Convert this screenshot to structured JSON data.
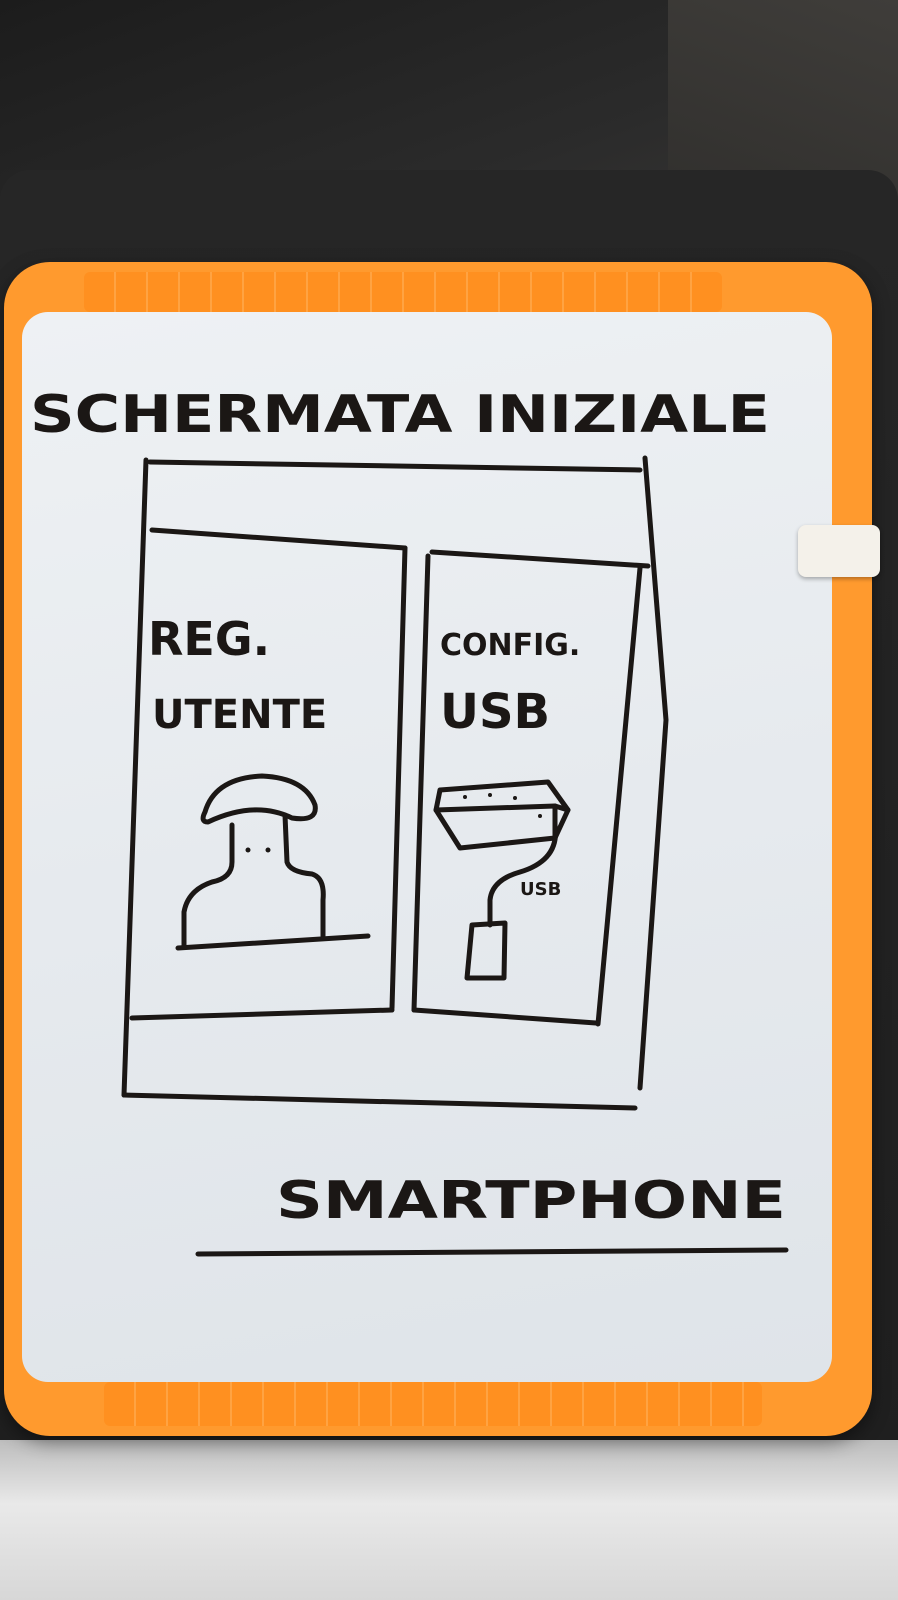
{
  "whiteboard": {
    "title": "SCHERMATA INIZIALE",
    "left_panel": {
      "line1": "REG.",
      "line2": "UTENTE"
    },
    "right_panel": {
      "line1": "CONFIG.",
      "line2": "USB",
      "cable_label": "USB"
    },
    "caption": "SMARTPHONE"
  },
  "colors": {
    "frame": "#ff9a2e",
    "board": "#e8ecf0",
    "ink": "#1b1715"
  }
}
